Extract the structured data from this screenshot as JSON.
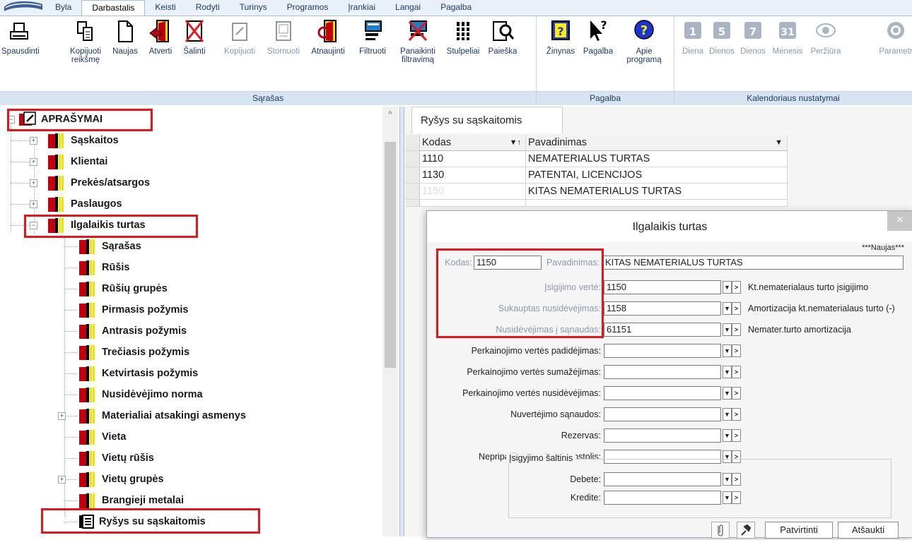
{
  "ribbon": {
    "tabs": [
      "Byla",
      "Darbastalis",
      "Keisti",
      "Rodyti",
      "Turinys",
      "Programos",
      "Įrankiai",
      "Langai",
      "Pagalba"
    ],
    "active_tab": "Darbastalis",
    "groups": {
      "sarasas": {
        "label": "Sąrašas",
        "buttons": {
          "print": "Spausdinti",
          "copy_value_1": "Kopijuoti",
          "copy_value_2": "reikšmę",
          "new": "Naujas",
          "open": "Atverti",
          "delete": "Šalinti",
          "copy": "Kopijuoti",
          "storno": "Stornuoti",
          "refresh": "Atnaujinti",
          "filter": "Filtruoti",
          "clear_filter_1": "Panaikinti",
          "clear_filter_2": "filtravimą",
          "columns": "Stulpeliai",
          "search": "Paieška"
        }
      },
      "pagalba": {
        "label": "Pagalba",
        "buttons": {
          "manual": "Žinynas",
          "help": "Pagalba",
          "about_1": "Apie",
          "about_2": "programą"
        }
      },
      "kalendorius": {
        "label": "Kalendoriaus nustatymai",
        "buttons": {
          "day": "Diena",
          "days5": "Dienos",
          "days7": "Dienos",
          "month": "Mėnesis",
          "view": "Peržiūra",
          "params": "Parametr"
        },
        "day_numbers": [
          "1",
          "5",
          "7",
          "31"
        ]
      }
    }
  },
  "tree": {
    "root": "APRAŠYMAI",
    "items": [
      "Sąskaitos",
      "Klientai",
      "Prekės/atsargos",
      "Paslaugos",
      "Ilgalaikis turtas"
    ],
    "children": [
      "Sąrašas",
      "Rūšis",
      "Rūšių grupės",
      "Pirmasis požymis",
      "Antrasis požymis",
      "Trečiasis požymis",
      "Ketvirtasis požymis",
      "Nusidėvėjimo norma",
      "Materialiai atsakingi asmenys",
      "Vieta",
      "Vietų rūšis",
      "Vietų grupės",
      "Brangieji metalai",
      "Ryšys su sąskaitomis"
    ]
  },
  "grid": {
    "tab_title": "Ryšys su sąskaitomis",
    "columns": [
      "Kodas",
      "Pavadinimas"
    ],
    "rows": [
      [
        "1110",
        "NEMATERIALUS TURTAS"
      ],
      [
        "1130",
        "PATENTAI, LICENCIJOS"
      ],
      [
        "1150",
        "KITAS NEMATERIALUS TURTAS"
      ]
    ]
  },
  "dialog": {
    "title": "Ilgalaikis turtas",
    "status": "***Naujas***",
    "code_label": "Kodas:",
    "code_value": "1150",
    "name_label": "Pavadinimas:",
    "name_value": "KITAS NEMATERIALUS TURTAS",
    "fields": [
      {
        "label": "Įsigijimo vertė:",
        "value": "1150",
        "desc": "Kt.nematerialaus turto įsigijimo"
      },
      {
        "label": "Sukauptas nusidėvėjimas:",
        "value": "1158",
        "desc": "Amortizacija kt.nematerialaus turto (-)"
      },
      {
        "label": "Nusidėvėjimas į sąnaudas:",
        "value": "61151",
        "desc": "Nemater.turto amortizacija"
      },
      {
        "label": "Perkainojimo vertės padidėjimas:",
        "value": "",
        "desc": ""
      },
      {
        "label": "Perkainojimo vertės sumažėjimas:",
        "value": "",
        "desc": ""
      },
      {
        "label": "Perkainojimo vertės nusidėvėjimas:",
        "value": "",
        "desc": ""
      },
      {
        "label": "Nuvertėjimo sąnaudos:",
        "value": "",
        "desc": ""
      },
      {
        "label": "Rezervas:",
        "value": "",
        "desc": ""
      },
      {
        "label": "Nepripažintas pelnas/nuostolis:",
        "value": "",
        "desc": ""
      }
    ],
    "source_legend": "Įsigyjimo šaltinis",
    "debit_label": "Debete:",
    "credit_label": "Kredite:",
    "confirm_label": "Patvirtinti",
    "cancel_label": "Atšaukti",
    "close_glyph": "×"
  }
}
